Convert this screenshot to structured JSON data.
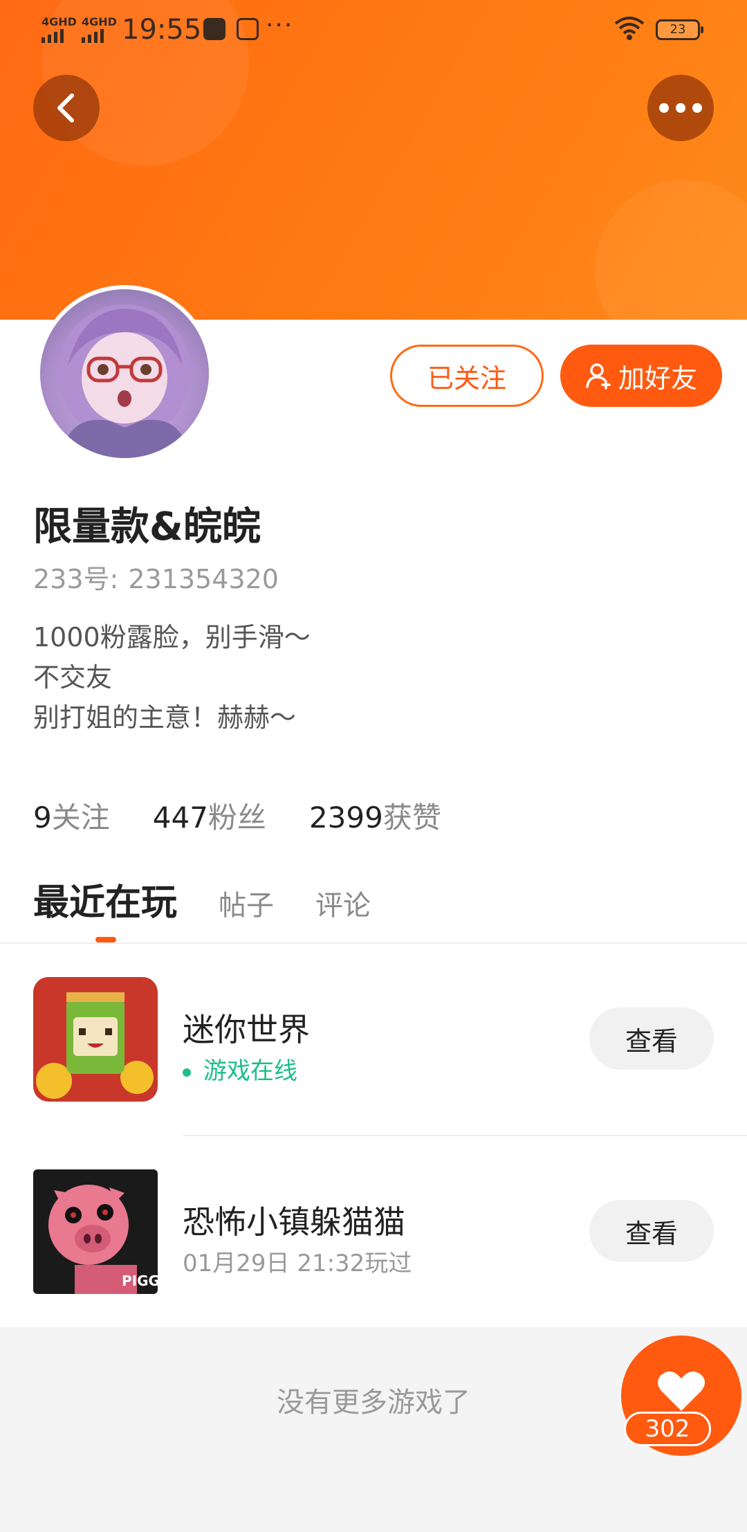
{
  "status_bar": {
    "network1": "4GHD",
    "network2": "4GHD",
    "time": "19:55",
    "more": "···",
    "battery": "23"
  },
  "profile": {
    "username": "限量款&皖皖",
    "id_label": "233号:",
    "id_value": "231354320",
    "bio_lines": [
      "1000粉露脸，别手滑～",
      "不交友",
      "别打姐的主意！赫赫～"
    ],
    "follow_button": "已关注",
    "add_friend_button": "加好友"
  },
  "stats": [
    {
      "num": "9",
      "label": "关注"
    },
    {
      "num": "447",
      "label": "粉丝"
    },
    {
      "num": "2399",
      "label": "获赞"
    }
  ],
  "tabs": [
    {
      "label": "最近在玩",
      "active": true
    },
    {
      "label": "帖子",
      "active": false
    },
    {
      "label": "评论",
      "active": false
    }
  ],
  "games": [
    {
      "name": "迷你世界",
      "status": "游戏在线",
      "button": "查看"
    },
    {
      "name": "恐怖小镇躲猫猫",
      "status": "01月29日 21:32玩过",
      "button": "查看",
      "icon_text": "PIGGY"
    }
  ],
  "footer": {
    "no_more": "没有更多游戏了",
    "like_count": "302"
  },
  "colors": {
    "accent": "#ff5a10",
    "online": "#1bbf87",
    "header_gradient": [
      "#ff6a13",
      "#ff8a1a"
    ]
  }
}
